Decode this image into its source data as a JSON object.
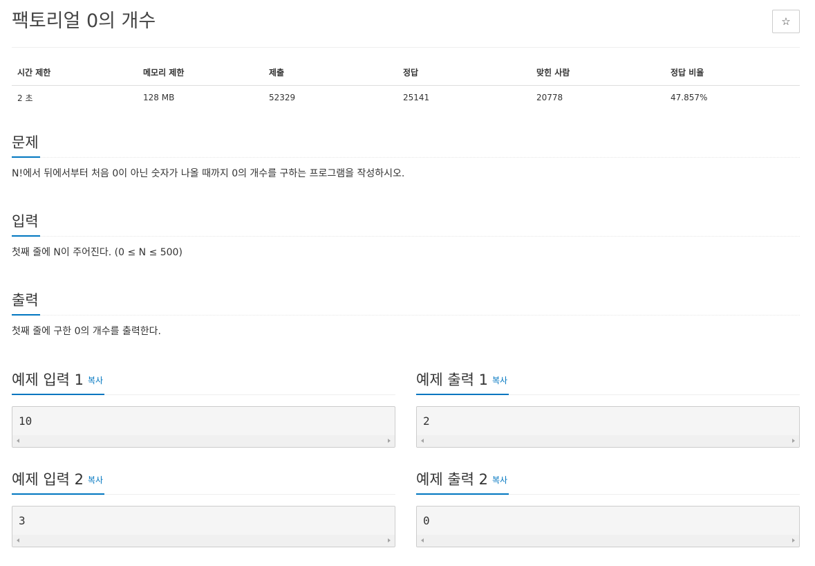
{
  "problem": {
    "title": "팩토리얼 0의 개수",
    "star_icon": "☆"
  },
  "info_table": {
    "headers": [
      "시간 제한",
      "메모리 제한",
      "제출",
      "정답",
      "맞힌 사람",
      "정답 비율"
    ],
    "values": [
      "2 초",
      "128 MB",
      "52329",
      "25141",
      "20778",
      "47.857%"
    ]
  },
  "sections": {
    "description": {
      "title": "문제",
      "text": "N!에서 뒤에서부터 처음 0이 아닌 숫자가 나올 때까지 0의 개수를 구하는 프로그램을 작성하시오."
    },
    "input": {
      "title": "입력",
      "text": "첫째 줄에 N이 주어진다. (0 ≤ N ≤ 500)"
    },
    "output": {
      "title": "출력",
      "text": "첫째 줄에 구한 0의 개수를 출력한다."
    }
  },
  "samples": {
    "copy_label": "복사",
    "input1": {
      "title": "예제 입력 1",
      "value": "10"
    },
    "output1": {
      "title": "예제 출력 1",
      "value": "2"
    },
    "input2": {
      "title": "예제 입력 2",
      "value": "3"
    },
    "output2": {
      "title": "예제 출력 2",
      "value": "0"
    }
  },
  "colors": {
    "accent": "#0076c0",
    "sample_bg": "#f5f5f5"
  }
}
